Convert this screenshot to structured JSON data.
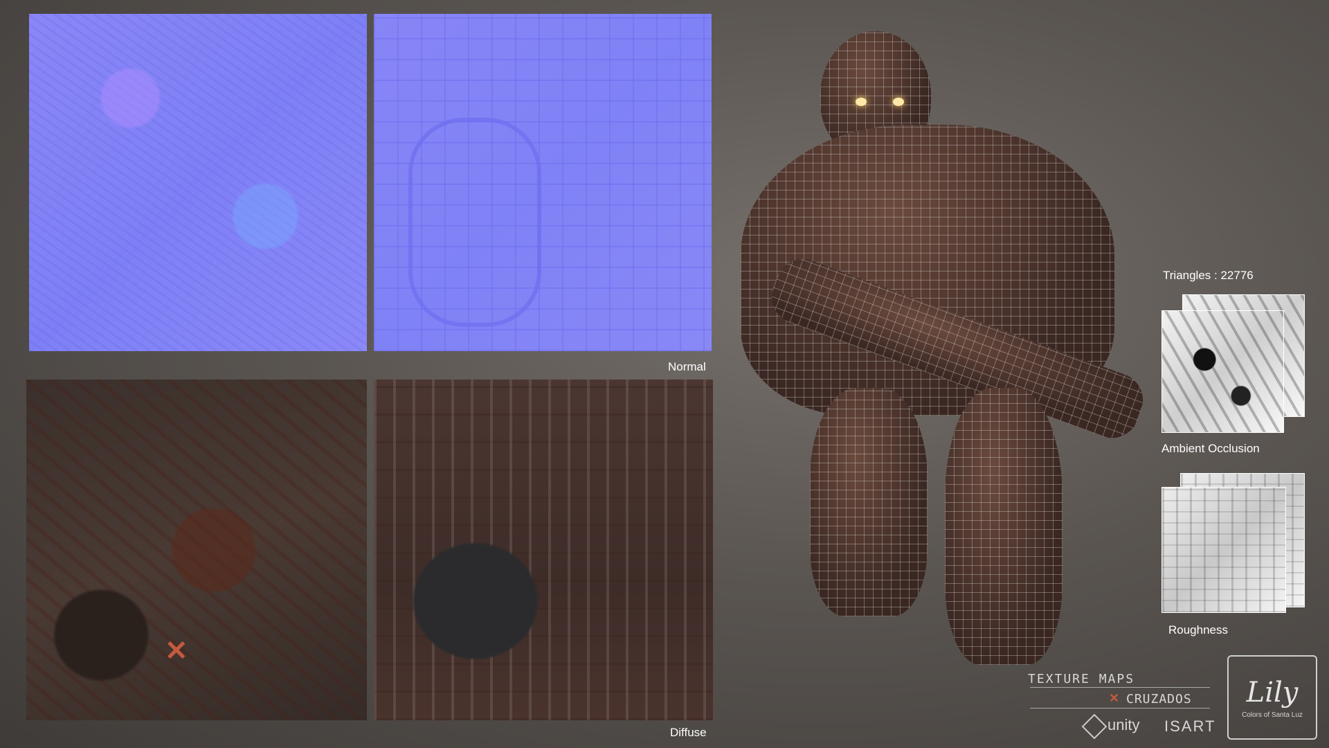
{
  "labels": {
    "normal": "Normal",
    "diffuse": "Diffuse",
    "triangles": "Triangles : 22776",
    "ambient_occlusion": "Ambient Occlusion",
    "roughness": "Roughness"
  },
  "branding": {
    "line1": "TEXTURE MAPS",
    "line2": "CRUZADOS",
    "engine": "unity",
    "studio": "ISART",
    "logo_title": "Lily",
    "logo_subtitle": "Colors of Santa Luz"
  },
  "colors": {
    "normal_map": "#8483f5",
    "diffuse_map": "#3e302b",
    "background": "#5a5551",
    "accent_x": "#c45a3f"
  }
}
